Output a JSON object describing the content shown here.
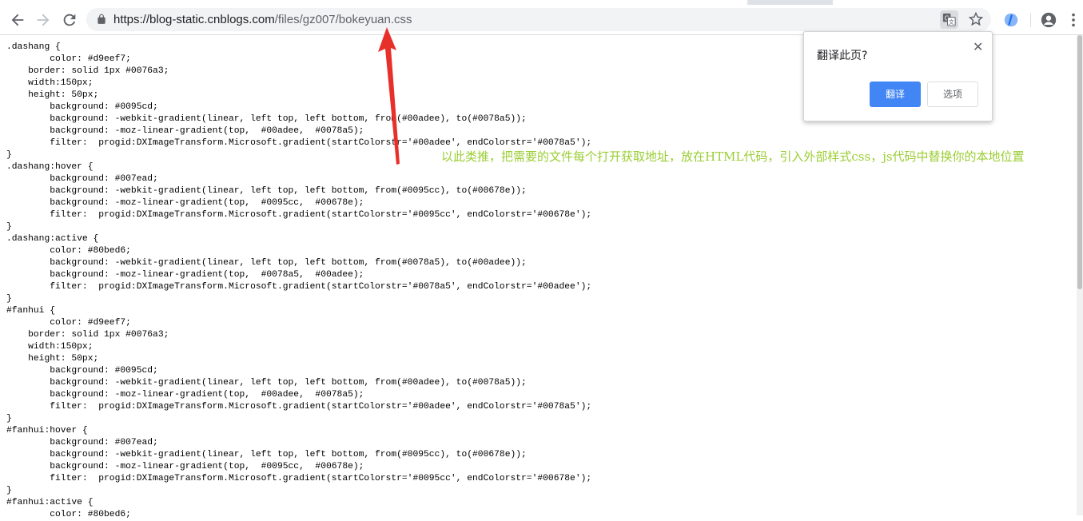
{
  "browser": {
    "url_host": "https://blog-static.cnblogs.com",
    "url_path": "/files/gz007/bokeyuan.css",
    "icons": {
      "back": "arrow-left-icon",
      "forward": "arrow-right-icon",
      "reload": "reload-icon",
      "lock": "lock-icon",
      "translate": "translate-icon",
      "bookmark": "star-icon",
      "extension": "extension-icon",
      "profile": "account-icon",
      "menu": "kebab-menu-icon"
    }
  },
  "translate_popup": {
    "title": "翻译此页?",
    "close": "✕",
    "translate_button": "翻译",
    "options_button": "选项",
    "accent_color": "#4285f4"
  },
  "annotation": {
    "text": "以此类推，把需要的文件每个打开获取地址，放在HTML代码，引入外部样式css，js代码中替换你的本地位置",
    "color": "#9acd32",
    "arrow_color": "#e8302b"
  },
  "css_lines": [
    ".dashang {",
    "        color: #d9eef7;",
    "    border: solid 1px #0076a3;",
    "    width:150px;",
    "    height: 50px;",
    "        background: #0095cd;",
    "        background: -webkit-gradient(linear, left top, left bottom, from(#00adee), to(#0078a5));",
    "        background: -moz-linear-gradient(top,  #00adee,  #0078a5);",
    "        filter:  progid:DXImageTransform.Microsoft.gradient(startColorstr='#00adee', endColorstr='#0078a5');",
    "}",
    ".dashang:hover {",
    "        background: #007ead;",
    "        background: -webkit-gradient(linear, left top, left bottom, from(#0095cc), to(#00678e));",
    "        background: -moz-linear-gradient(top,  #0095cc,  #00678e);",
    "        filter:  progid:DXImageTransform.Microsoft.gradient(startColorstr='#0095cc', endColorstr='#00678e');",
    "}",
    ".dashang:active {",
    "        color: #80bed6;",
    "        background: -webkit-gradient(linear, left top, left bottom, from(#0078a5), to(#00adee));",
    "        background: -moz-linear-gradient(top,  #0078a5,  #00adee);",
    "        filter:  progid:DXImageTransform.Microsoft.gradient(startColorstr='#0078a5', endColorstr='#00adee');",
    "}",
    "#fanhui {",
    "        color: #d9eef7;",
    "    border: solid 1px #0076a3;",
    "    width:150px;",
    "    height: 50px;",
    "        background: #0095cd;",
    "        background: -webkit-gradient(linear, left top, left bottom, from(#00adee), to(#0078a5));",
    "        background: -moz-linear-gradient(top,  #00adee,  #0078a5);",
    "        filter:  progid:DXImageTransform.Microsoft.gradient(startColorstr='#00adee', endColorstr='#0078a5');",
    "}",
    "#fanhui:hover {",
    "        background: #007ead;",
    "        background: -webkit-gradient(linear, left top, left bottom, from(#0095cc), to(#00678e));",
    "        background: -moz-linear-gradient(top,  #0095cc,  #00678e);",
    "        filter:  progid:DXImageTransform.Microsoft.gradient(startColorstr='#0095cc', endColorstr='#00678e');",
    "}",
    "#fanhui:active {",
    "        color: #80bed6;"
  ]
}
